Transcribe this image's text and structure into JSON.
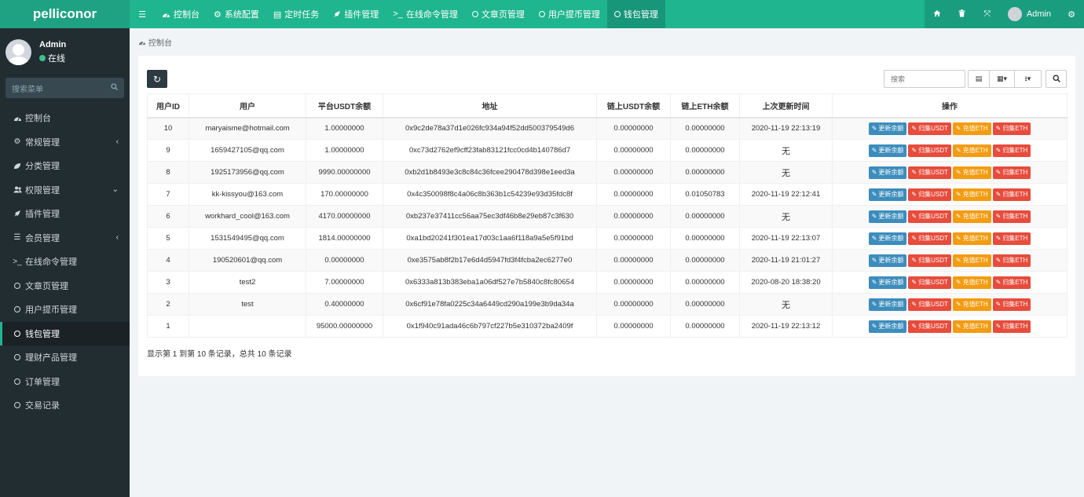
{
  "app": {
    "logo": "pelliconor"
  },
  "topnav": {
    "items": [
      {
        "label": "控制台",
        "icon": "dashboard-icon"
      },
      {
        "label": "系统配置",
        "icon": "gear-icon"
      },
      {
        "label": "定时任务",
        "icon": "list-icon"
      },
      {
        "label": "插件管理",
        "icon": "rocket-icon"
      },
      {
        "label": "在线命令管理",
        "icon": "terminal-icon"
      },
      {
        "label": "文章页管理",
        "icon": "circle-icon"
      },
      {
        "label": "用户提币管理",
        "icon": "circle-icon"
      },
      {
        "label": "钱包管理",
        "icon": "circle-icon"
      }
    ],
    "user": "Admin"
  },
  "sidebar": {
    "user_name": "Admin",
    "status": "在线",
    "search_placeholder": "搜索菜单",
    "items": [
      {
        "label": "控制台",
        "icon": "dashboard-icon"
      },
      {
        "label": "常规管理",
        "icon": "gears-icon",
        "arrow": "‹"
      },
      {
        "label": "分类管理",
        "icon": "leaf-icon"
      },
      {
        "label": "权限管理",
        "icon": "users-icon",
        "arrow": "⌄"
      },
      {
        "label": "插件管理",
        "icon": "rocket-icon"
      },
      {
        "label": "会员管理",
        "icon": "list-icon",
        "arrow": "‹"
      },
      {
        "label": "在线命令管理",
        "icon": "terminal-icon"
      },
      {
        "label": "文章页管理",
        "icon": "circle-icon"
      },
      {
        "label": "用户提币管理",
        "icon": "circle-icon"
      },
      {
        "label": "钱包管理",
        "icon": "circle-icon"
      },
      {
        "label": "理财产品管理",
        "icon": "circle-icon"
      },
      {
        "label": "订单管理",
        "icon": "circle-icon"
      },
      {
        "label": "交易记录",
        "icon": "circle-icon"
      }
    ]
  },
  "breadcrumb": "控制台",
  "toolbar": {
    "search_placeholder": "搜索"
  },
  "table": {
    "headers": [
      "用户ID",
      "用户",
      "平台USDT余额",
      "地址",
      "链上USDT余额",
      "链上ETH余额",
      "上次更新时间",
      "操作"
    ],
    "actions": [
      "更新余额",
      "归集USDT",
      "充值ETH",
      "归集ETH"
    ],
    "rows": [
      [
        "10",
        "maryaisme@hotmail.com",
        "1.00000000",
        "0x9c2de78a37d1e026fc934a94f52dd500379549d6",
        "0.00000000",
        "0.00000000",
        "2020-11-19 22:13:19"
      ],
      [
        "9",
        "1659427105@qq.com",
        "1.00000000",
        "0xc73d2762ef9cff23fab83121fcc0cd4b140786d7",
        "0.00000000",
        "0.00000000",
        "无"
      ],
      [
        "8",
        "1925173956@qq.com",
        "9990.00000000",
        "0xb2d1b8493e3c8c84c36fcee290478d398e1eed3a",
        "0.00000000",
        "0.00000000",
        "无"
      ],
      [
        "7",
        "kk-kissyou@163.com",
        "170.00000000",
        "0x4c350098f8c4a06c8b363b1c54239e93d35fdc8f",
        "0.00000000",
        "0.01050783",
        "2020-11-19 22:12:41"
      ],
      [
        "6",
        "workhard_cool@163.com",
        "4170.00000000",
        "0xb237e37411cc56aa75ec3df46b8e29eb87c3f630",
        "0.00000000",
        "0.00000000",
        "无"
      ],
      [
        "5",
        "1531549495@qq.com",
        "1814.00000000",
        "0xa1bd20241f301ea17d03c1aa6f118a9a5e5f91bd",
        "0.00000000",
        "0.00000000",
        "2020-11-19 22:13:07"
      ],
      [
        "4",
        "190520601@qq.com",
        "0.00000000",
        "0xe3575ab8f2b17e6d4d5947fd3f4fcba2ec6277e0",
        "0.00000000",
        "0.00000000",
        "2020-11-19 21:01:27"
      ],
      [
        "3",
        "test2",
        "7.00000000",
        "0x6333a813b383eba1a06df527e7b5840c8fc80654",
        "0.00000000",
        "0.00000000",
        "2020-08-20 18:38:20"
      ],
      [
        "2",
        "test",
        "0.40000000",
        "0x6cf91e78fa0225c34a6449cd290a199e3b9da34a",
        "0.00000000",
        "0.00000000",
        "无"
      ],
      [
        "1",
        "",
        "95000.00000000",
        "0x1f940c91ada46c6b797cf227b5e310372ba2409f",
        "0.00000000",
        "0.00000000",
        "2020-11-19 22:13:12"
      ]
    ]
  },
  "pagination_text": "显示第 1 到第 10 条记录，总共 10 条记录",
  "colors": {
    "primary": "#1fb58e",
    "sidebar": "#222d32",
    "btn_blue": "#3c8dbc",
    "btn_red": "#e74c3c",
    "btn_orange": "#f39c12"
  }
}
